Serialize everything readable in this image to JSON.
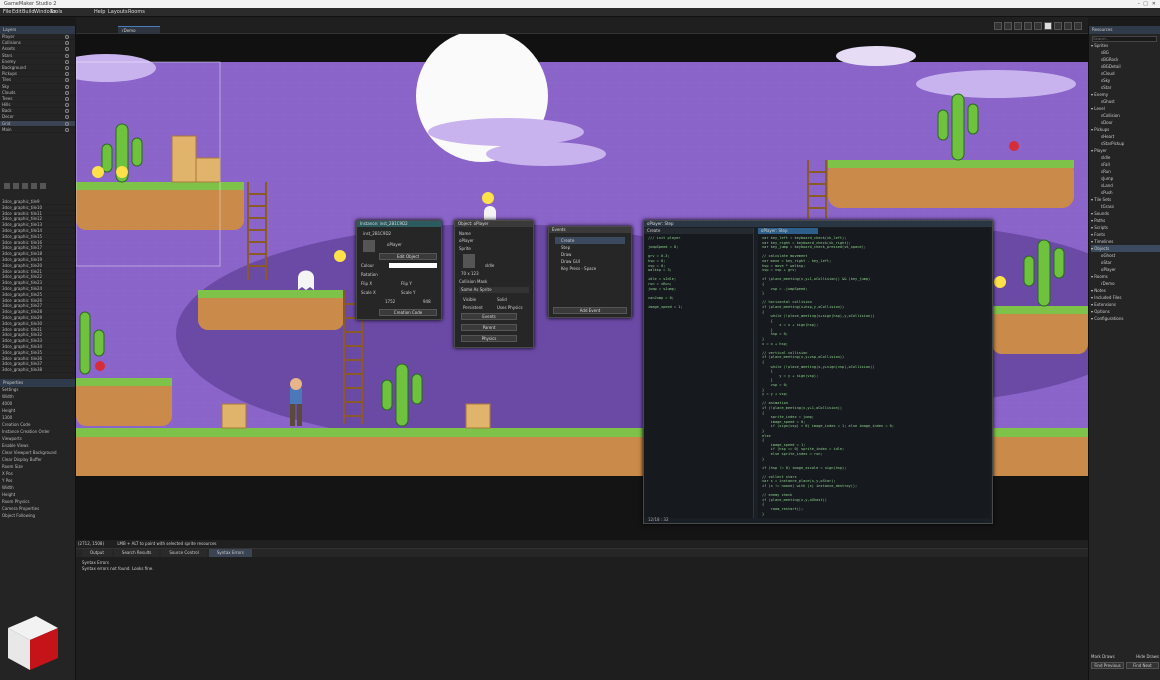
{
  "window": {
    "title": "GameMaker Studio 2",
    "controls": [
      "–",
      "□",
      "✕"
    ]
  },
  "menubar": {
    "items": [
      "File",
      "Edit",
      "Build",
      "Windows",
      "Tools",
      "Help",
      "Layouts",
      "Rooms"
    ]
  },
  "room_tab": {
    "label": "rDemo"
  },
  "left": {
    "layers_header": "Layers",
    "layers": [
      "Player",
      "Collisions",
      "Assets",
      "Stars",
      "Enemy",
      "Background",
      "Pickups",
      "Tiles",
      "Sky",
      "Clouds",
      "Trees",
      "Hills",
      "Back",
      "Decor",
      "Grid",
      "Main"
    ],
    "assets_list": [
      "3dce_graphic_tile9",
      "3dce_graphic_tile10",
      "3dce_graphic_tile11",
      "3dce_graphic_tile12",
      "3dce_graphic_tile13",
      "3dce_graphic_tile14",
      "3dce_graphic_tile15",
      "3dce_graphic_tile16",
      "3dce_graphic_tile17",
      "3dce_graphic_tile18",
      "3dce_graphic_tile19",
      "3dce_graphic_tile20",
      "3dce_graphic_tile21",
      "3dce_graphic_tile22",
      "3dce_graphic_tile23",
      "3dce_graphic_tile24",
      "3dce_graphic_tile25",
      "3dce_graphic_tile26",
      "3dce_graphic_tile27",
      "3dce_graphic_tile28",
      "3dce_graphic_tile29",
      "3dce_graphic_tile30",
      "3dce_graphic_tile31",
      "3dce_graphic_tile32",
      "3dce_graphic_tile33",
      "3dce_graphic_tile34",
      "3dce_graphic_tile35",
      "3dce_graphic_tile36",
      "3dce_graphic_tile37",
      "3dce_graphic_tile38"
    ],
    "properties_header": "Properties",
    "props": [
      "Settings",
      "Width",
      "4000",
      "Height",
      "1300",
      "Creation Code",
      "Instance Creation Order",
      "Viewports",
      "Enable Views",
      "Clear Viewport Background",
      "Clear Display Buffer",
      "Room Size",
      "X Pos",
      "Y Pos",
      "Width",
      "Height",
      "Room Physics",
      "Camera Properties",
      "Object Following"
    ]
  },
  "right": {
    "header": "Resources",
    "search_placeholder": "Search...",
    "groups": [
      {
        "label": "Sprites",
        "items": [
          "sBG",
          "sBGRock",
          "sBGDetail",
          "sCloud",
          "sSky",
          "sStar"
        ]
      },
      {
        "label": "Enemy",
        "items": [
          "sGhost"
        ]
      },
      {
        "label": "Level",
        "items": [
          "sCollision",
          "sDoor"
        ]
      },
      {
        "label": "Pickups",
        "items": [
          "sHeart",
          "sStarPickup"
        ]
      },
      {
        "label": "Player",
        "items": [
          "sIdle",
          "sFall",
          "sRun",
          "sJump",
          "sLand",
          "sPush"
        ]
      },
      {
        "label": "Tile Sets",
        "items": [
          "tGrass"
        ]
      },
      {
        "label": "Sounds",
        "items": []
      },
      {
        "label": "Paths",
        "items": []
      },
      {
        "label": "Scripts",
        "items": []
      },
      {
        "label": "Fonts",
        "items": []
      },
      {
        "label": "Timelines",
        "items": []
      },
      {
        "label": "Objects",
        "items": [
          "oGhost",
          "oStar",
          "oPlayer"
        ]
      },
      {
        "label": "Rooms",
        "items": [
          "rDemo"
        ]
      },
      {
        "label": "Notes",
        "items": []
      },
      {
        "label": "Included Files",
        "items": []
      },
      {
        "label": "Extensions",
        "items": []
      },
      {
        "label": "Options",
        "items": []
      },
      {
        "label": "Configurations",
        "items": []
      }
    ],
    "footer": [
      "Mark Draws",
      "Hide Draws",
      "Find Previous",
      "Find Next"
    ]
  },
  "status": {
    "coords": "(2712, 1508)",
    "hint": "LMB + ALT to paint with selected sprite resources"
  },
  "output": {
    "tabs": [
      "Output",
      "Search Results",
      "Source Control",
      "Syntax Errors"
    ],
    "title": "Syntax Errors",
    "lines": [
      "Syntax Errors",
      "Syntax errors not found. Looks fine."
    ]
  },
  "instance_win": {
    "title": "Instance: inst_2B1C9D2",
    "name": "inst_2B1C9D2",
    "object": "oPlayer",
    "edit": "Edit Object",
    "color": "Colour",
    "rotation": "Rotation",
    "flip_x": "Flip X",
    "flip_y": "Flip Y",
    "scale_x": "Scale X",
    "scale_y": "Scale Y",
    "x": "1752",
    "y": "948",
    "code": "Creation Code"
  },
  "object_win": {
    "title": "Object: oPlayer",
    "name_label": "Name",
    "name": "oPlayer",
    "sprite_label": "Sprite",
    "sprite": "sIdle",
    "size": "70 x 123",
    "collision": "Collision Mask",
    "collision_val": "Same As Sprite",
    "visible": "Visible",
    "solid": "Solid",
    "persistent": "Persistent",
    "uses_physics": "Uses Physics",
    "events": "Events",
    "parent": "Parent",
    "physics": "Physics"
  },
  "events_win": {
    "title": "Events",
    "items": [
      "Create",
      "Step",
      "Draw",
      "Draw GUI",
      "Key Press - Space"
    ],
    "add": "Add Event"
  },
  "code_win": {
    "title": "oPlayer: Step",
    "tabs": [
      "Create",
      "oPlayer: Step"
    ],
    "footer": "12/18 : 32",
    "left_code": [
      "/// init player",
      "",
      "jumpSpeed = 8;",
      "",
      "grv = 0.3;",
      "hsp = 0;",
      "vsp = 0;",
      "walksp = 3;",
      "",
      "idle = sIdle;",
      "run = sRun;",
      "jump = sJump;",
      "",
      "canJump = 0;",
      "",
      "image_speed = 1;"
    ],
    "right_code": [
      "var key_left = keyboard_check(vk_left);",
      "var key_right = keyboard_check(vk_right);",
      "var key_jump = keyboard_check_pressed(vk_space);",
      "",
      "// calculate movement",
      "var move = key_right - key_left;",
      "hsp = move * walksp;",
      "vsp = vsp + grv;",
      "",
      "if (place_meeting(x,y+1,oCollision)) && (key_jump)",
      "{",
      "    vsp = -jumpSpeed;",
      "}",
      "",
      "// horizontal collision",
      "if (place_meeting(x+hsp,y,oCollision))",
      "{",
      "    while (!place_meeting(x+sign(hsp),y,oCollision))",
      "    {",
      "        x = x + sign(hsp);",
      "    }",
      "    hsp = 0;",
      "}",
      "x = x + hsp;",
      "",
      "// vertical collision",
      "if (place_meeting(x,y+vsp,oCollision))",
      "{",
      "    while (!place_meeting(x,y+sign(vsp),oCollision))",
      "    {",
      "        y = y + sign(vsp);",
      "    }",
      "    vsp = 0;",
      "}",
      "y = y + vsp;",
      "",
      "// animation",
      "if (!place_meeting(x,y+1,oCollision))",
      "{",
      "    sprite_index = jump;",
      "    image_speed = 0;",
      "    if (sign(vsp) > 0) image_index = 1; else image_index = 0;",
      "}",
      "else",
      "{",
      "    image_speed = 1;",
      "    if (hsp == 0) sprite_index = idle;",
      "    else sprite_index = run;",
      "}",
      "",
      "if (hsp != 0) image_xscale = sign(hsp);",
      "",
      "// collect stars",
      "var s = instance_place(x,y,oStar);",
      "if (s != noone) with (s) instance_destroy();",
      "",
      "// enemy check",
      "if (place_meeting(x,y,oGhost))",
      "{",
      "    room_restart();",
      "}",
      "",
      "// end step"
    ]
  },
  "colors": {
    "sky": "#8a64c9",
    "sky_light": "#a886dc",
    "grass": "#7fc24a",
    "dirt": "#c98a4a",
    "panel": "#242424",
    "accent": "#3a6ea5"
  },
  "logo": "p30download"
}
